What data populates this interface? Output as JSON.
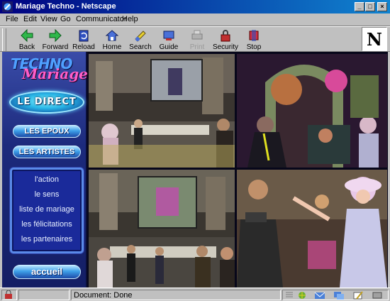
{
  "window": {
    "title": "Mariage Techno - Netscape"
  },
  "menu": [
    "File",
    "Edit",
    "View",
    "Go",
    "Communicator",
    "Help"
  ],
  "toolbar": [
    {
      "label": "Back",
      "icon": "back-arrow-icon",
      "enabled": true
    },
    {
      "label": "Forward",
      "icon": "forward-arrow-icon",
      "enabled": true
    },
    {
      "label": "Reload",
      "icon": "reload-icon",
      "enabled": true
    },
    {
      "label": "Home",
      "icon": "home-icon",
      "enabled": true
    },
    {
      "label": "Search",
      "icon": "search-icon",
      "enabled": true
    },
    {
      "label": "Guide",
      "icon": "guide-icon",
      "enabled": true
    },
    {
      "label": "Print",
      "icon": "print-icon",
      "enabled": false
    },
    {
      "label": "Security",
      "icon": "security-lock-icon",
      "enabled": true
    },
    {
      "label": "Stop",
      "icon": "stop-icon",
      "enabled": true
    }
  ],
  "throbber": {
    "letter": "N"
  },
  "site": {
    "logo_line1": "TECHNO",
    "logo_line2": "Mariage",
    "direct_button": "LE DIRECT",
    "epoux_button": "LES EPOUX",
    "artistes_button": "LES ARTISTES",
    "nav_links": [
      "l'action",
      "le sens",
      "liste de mariage",
      "les félicitations",
      "les partenaires"
    ],
    "accueil_button": "accueil"
  },
  "status": {
    "text": "Document: Done"
  },
  "colors": {
    "title_bar": "#000080",
    "chrome": "#c0c0c0",
    "sidebar": "#1c2a7c",
    "accent_pink": "#ff5ec8",
    "accent_cyan": "#2ab8e8"
  }
}
